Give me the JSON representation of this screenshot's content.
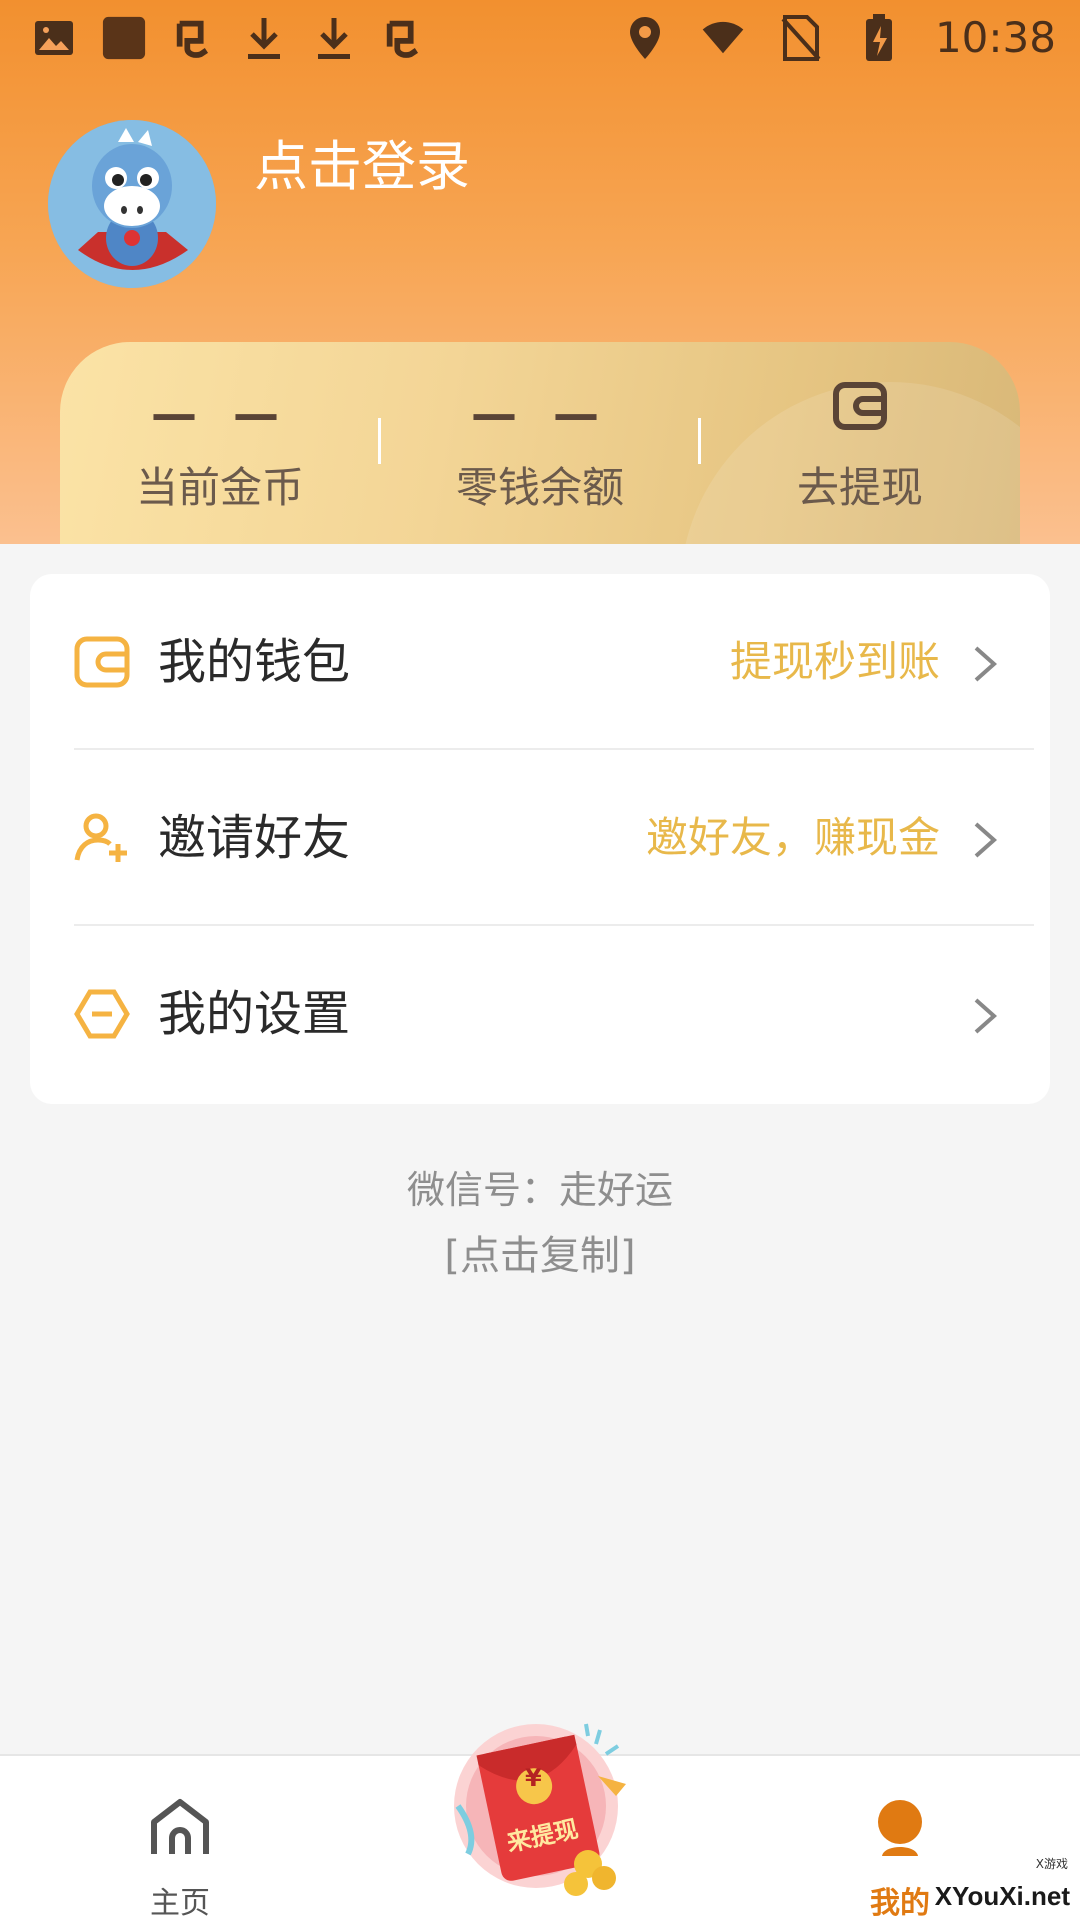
{
  "status_bar": {
    "time": "10:38",
    "left_icons": [
      "image-icon",
      "app-square-icon",
      "bug-icon",
      "download-icon",
      "download-icon",
      "bug-icon"
    ],
    "right_icons": [
      "location-icon",
      "wifi-icon",
      "no-sim-icon",
      "battery-charging-icon"
    ]
  },
  "profile": {
    "login_label": "点击登录",
    "avatar": "horse-mascot-avatar"
  },
  "stats": [
    {
      "value": "— —",
      "label": "当前金币"
    },
    {
      "value": "— —",
      "label": "零钱余额"
    },
    {
      "value": "",
      "label": "去提现",
      "icon": "wallet-icon"
    }
  ],
  "menu": [
    {
      "label": "我的钱包",
      "hint": "提现秒到账",
      "icon": "wallet-icon"
    },
    {
      "label": "邀请好友",
      "hint": "邀好友，赚现金",
      "icon": "add-user-icon"
    },
    {
      "label": "我的设置",
      "hint": "",
      "icon": "settings-hexagon-icon"
    }
  ],
  "wechat": {
    "id_label": "微信号：走好运",
    "copy_label": "[点击复制]"
  },
  "bottom_nav": {
    "home_label": "主页",
    "center_label": "来提现",
    "center_symbol": "¥",
    "mine_label": "我的"
  },
  "watermark": {
    "text": "XYouXi.net",
    "small": "X游戏"
  },
  "colors": {
    "header_orange": "#f2902f",
    "accent_gold": "#e8b84a",
    "active_tab": "#e07a12"
  }
}
